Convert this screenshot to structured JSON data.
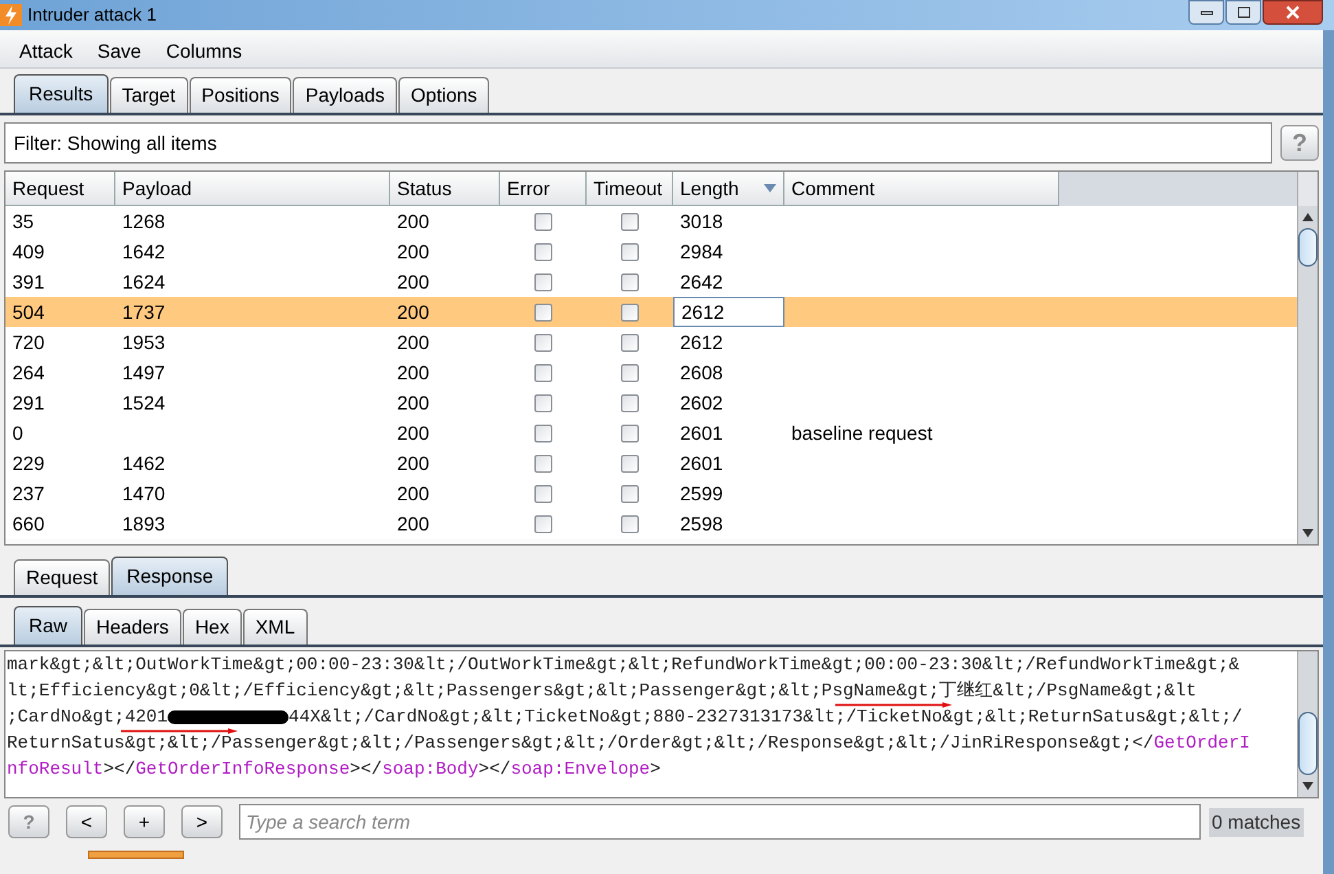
{
  "window": {
    "title": "Intruder attack 1"
  },
  "menu": [
    "Attack",
    "Save",
    "Columns"
  ],
  "tabs": [
    {
      "label": "Results",
      "selected": true
    },
    {
      "label": "Target",
      "selected": false
    },
    {
      "label": "Positions",
      "selected": false
    },
    {
      "label": "Payloads",
      "selected": false
    },
    {
      "label": "Options",
      "selected": false
    }
  ],
  "filter": {
    "text": "Filter: Showing all items",
    "help": "?"
  },
  "table": {
    "columns": [
      {
        "label": "Request",
        "sorted": false
      },
      {
        "label": "Payload",
        "sorted": false
      },
      {
        "label": "Status",
        "sorted": false
      },
      {
        "label": "Error",
        "sorted": false
      },
      {
        "label": "Timeout",
        "sorted": false
      },
      {
        "label": "Length",
        "sorted": true
      },
      {
        "label": "Comment",
        "sorted": false
      }
    ],
    "rows": [
      {
        "request": "35",
        "payload": "1268",
        "status": "200",
        "error": false,
        "timeout": false,
        "length": "3018",
        "comment": "",
        "selected": false
      },
      {
        "request": "409",
        "payload": "1642",
        "status": "200",
        "error": false,
        "timeout": false,
        "length": "2984",
        "comment": "",
        "selected": false
      },
      {
        "request": "391",
        "payload": "1624",
        "status": "200",
        "error": false,
        "timeout": false,
        "length": "2642",
        "comment": "",
        "selected": false
      },
      {
        "request": "504",
        "payload": "1737",
        "status": "200",
        "error": false,
        "timeout": false,
        "length": "2612",
        "comment": "",
        "selected": true
      },
      {
        "request": "720",
        "payload": "1953",
        "status": "200",
        "error": false,
        "timeout": false,
        "length": "2612",
        "comment": "",
        "selected": false
      },
      {
        "request": "264",
        "payload": "1497",
        "status": "200",
        "error": false,
        "timeout": false,
        "length": "2608",
        "comment": "",
        "selected": false
      },
      {
        "request": "291",
        "payload": "1524",
        "status": "200",
        "error": false,
        "timeout": false,
        "length": "2602",
        "comment": "",
        "selected": false
      },
      {
        "request": "0",
        "payload": "",
        "status": "200",
        "error": false,
        "timeout": false,
        "length": "2601",
        "comment": "baseline request",
        "selected": false
      },
      {
        "request": "229",
        "payload": "1462",
        "status": "200",
        "error": false,
        "timeout": false,
        "length": "2601",
        "comment": "",
        "selected": false
      },
      {
        "request": "237",
        "payload": "1470",
        "status": "200",
        "error": false,
        "timeout": false,
        "length": "2599",
        "comment": "",
        "selected": false
      },
      {
        "request": "660",
        "payload": "1893",
        "status": "200",
        "error": false,
        "timeout": false,
        "length": "2598",
        "comment": "",
        "selected": false
      }
    ]
  },
  "message_tabs": [
    {
      "label": "Request",
      "selected": false
    },
    {
      "label": "Response",
      "selected": true
    }
  ],
  "view_tabs": [
    {
      "label": "Raw",
      "selected": true
    },
    {
      "label": "Headers",
      "selected": false
    },
    {
      "label": "Hex",
      "selected": false
    },
    {
      "label": "XML",
      "selected": false
    }
  ],
  "response_lines": [
    [
      {
        "kind": "plain",
        "text": "mark&gt;&lt;OutWorkTime&gt;00:00-23:30&lt;/OutWorkTime&gt;&lt;RefundWorkTime&gt;00:00-23:30&lt;/RefundWorkTime&gt;&"
      }
    ],
    [
      {
        "kind": "plain",
        "text": "lt;Efficiency&gt;0&lt;/Efficiency&gt;&lt;Passengers&gt;&lt;Passenger&gt;&lt;PsgName&gt;"
      },
      {
        "kind": "plain",
        "text": "丁继红",
        "arrow": true
      },
      {
        "kind": "plain",
        "text": "&lt;/PsgName&gt;&lt"
      }
    ],
    [
      {
        "kind": "plain",
        "text": ";CardNo&gt;"
      },
      {
        "kind": "plain",
        "text": "4201",
        "arrow": true
      },
      {
        "kind": "redacted"
      },
      {
        "kind": "plain",
        "text": "44X&lt;/CardNo&gt;&lt;TicketNo&gt;880-2327313173&lt;/TicketNo&gt;&lt;ReturnSatus&gt;&lt;/"
      }
    ],
    [
      {
        "kind": "plain",
        "text": "ReturnSatus&gt;&lt;/Passenger&gt;&lt;/Passengers&gt;&lt;/Order&gt;&lt;/Response&gt;&lt;/JinRiResponse&gt;</"
      },
      {
        "kind": "tag",
        "text": "GetOrderI"
      }
    ],
    [
      {
        "kind": "tag",
        "text": "nfoResult"
      },
      {
        "kind": "plain",
        "text": "></"
      },
      {
        "kind": "tag",
        "text": "GetOrderInfoResponse"
      },
      {
        "kind": "plain",
        "text": "></"
      },
      {
        "kind": "tag",
        "text": "soap:Body"
      },
      {
        "kind": "plain",
        "text": "></"
      },
      {
        "kind": "tag",
        "text": "soap:Envelope"
      },
      {
        "kind": "plain",
        "text": ">"
      }
    ]
  ],
  "progress": {
    "level": 0.08
  },
  "search": {
    "buttons": [
      "?",
      "<",
      "+",
      ">"
    ],
    "placeholder": "Type a search term",
    "matches": "0 matches"
  }
}
